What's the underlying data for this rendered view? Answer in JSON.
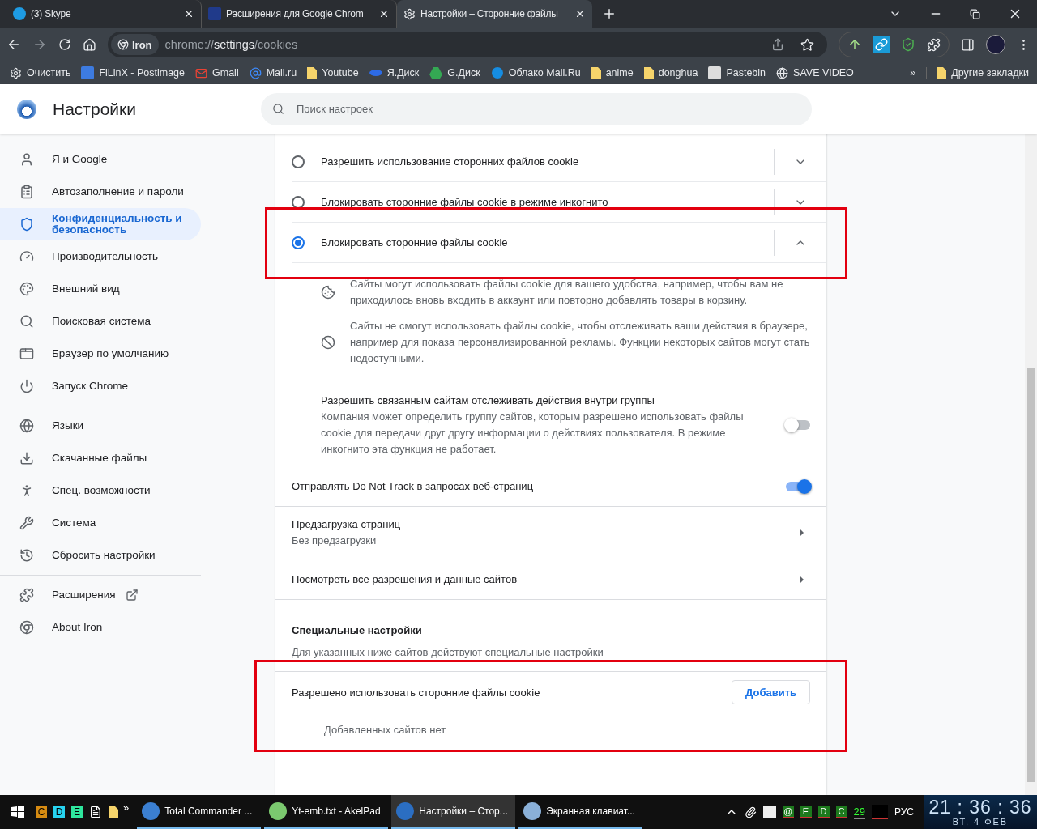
{
  "tabs": [
    {
      "title": "(3) Skype",
      "selected": false
    },
    {
      "title": "Расширения для Google Chrom",
      "selected": false
    },
    {
      "title": "Настройки – Сторонние файлы",
      "selected": true
    }
  ],
  "address": {
    "badge": "Iron",
    "url_scheme": "chrome://",
    "url_host": "settings",
    "url_path": "/cookies"
  },
  "bookmarks": [
    {
      "label": "Очистить"
    },
    {
      "label": "FiLinX - Postimage"
    },
    {
      "label": "Gmail"
    },
    {
      "label": "Mail.ru"
    },
    {
      "label": "Youtube"
    },
    {
      "label": "Я.Диск"
    },
    {
      "label": "G.Диск"
    },
    {
      "label": "Облако Mail.Ru"
    },
    {
      "label": "anime"
    },
    {
      "label": "donghua"
    },
    {
      "label": "Pastebin"
    },
    {
      "label": "SAVE VIDEO"
    }
  ],
  "bookmarks_overflow": "»",
  "other_bookmarks": "Другие закладки",
  "settings": {
    "title": "Настройки",
    "search_placeholder": "Поиск настроек"
  },
  "sidebar": {
    "groups": [
      [
        {
          "label": "Я и Google",
          "selected": false
        },
        {
          "label": "Автозаполнение и пароли",
          "selected": false
        },
        {
          "label": "Конфиденциальность и безопасность",
          "selected": true
        },
        {
          "label": "Производительность",
          "selected": false
        },
        {
          "label": "Внешний вид",
          "selected": false
        },
        {
          "label": "Поисковая система",
          "selected": false
        },
        {
          "label": "Браузер по умолчанию",
          "selected": false
        },
        {
          "label": "Запуск Chrome",
          "selected": false
        }
      ],
      [
        {
          "label": "Языки",
          "selected": false
        },
        {
          "label": "Скачанные файлы",
          "selected": false
        },
        {
          "label": "Спец. возможности",
          "selected": false
        },
        {
          "label": "Система",
          "selected": false
        },
        {
          "label": "Сбросить настройки",
          "selected": false
        }
      ],
      [
        {
          "label": "Расширения",
          "selected": false
        },
        {
          "label": "About Iron",
          "selected": false
        }
      ]
    ]
  },
  "cookie_options": [
    {
      "label": "Разрешить использование сторонних файлов cookie",
      "selected": false,
      "expanded": false,
      "highlighted": false
    },
    {
      "label": "Блокировать сторонние файлы cookie в режиме инкогнито",
      "selected": false,
      "expanded": false,
      "highlighted": false
    },
    {
      "label": "Блокировать сторонние файлы cookie",
      "selected": true,
      "expanded": true,
      "highlighted": true
    }
  ],
  "details": [
    {
      "kind": "allow",
      "text": "Сайты могут использовать файлы cookie для вашего удобства, например, чтобы вам не приходилось вновь входить в аккаунт или повторно добавлять товары в корзину."
    },
    {
      "kind": "block",
      "text": "Сайты не смогут использовать файлы cookie, чтобы отслеживать ваши действия в браузере, например для показа персонализированной рекламы. Функции некоторых сайтов могут стать недоступными."
    }
  ],
  "related_sites": {
    "title": "Разрешить связанным сайтам отслеживать действия внутри группы",
    "description": "Компания может определить группу сайтов, которым разрешено использовать файлы cookie для передачи друг другу информации о действиях пользователя. В режиме инкогнито эта функция не работает.",
    "on": false
  },
  "rows": [
    {
      "kind": "toggle",
      "title": "Отправлять Do Not Track в запросах веб-страниц",
      "on": true
    },
    {
      "kind": "link",
      "title": "Предзагрузка страниц",
      "subtitle": "Без предзагрузки"
    },
    {
      "kind": "link",
      "title": "Посмотреть все разрешения и данные сайтов"
    }
  ],
  "special": {
    "heading": "Специальные настройки",
    "description": "Для указанных ниже сайтов действуют специальные настройки",
    "highlighted": true,
    "allowed_label": "Разрешено использовать сторонние файлы cookie",
    "add_button": "Добавить",
    "empty": "Добавленных сайтов нет"
  },
  "taskbar": {
    "quick_launch": [
      "C",
      "D",
      "E"
    ],
    "overflow": "»",
    "tasks": [
      {
        "title": "Total Commander ...",
        "selected": false
      },
      {
        "title": "Yt-emb.txt - AkelPad",
        "selected": false
      },
      {
        "title": "Настройки – Стор...",
        "selected": true
      },
      {
        "title": "Экранная клавиат...",
        "selected": false
      }
    ],
    "tray_letters": [
      "@",
      "E",
      "D",
      "C"
    ],
    "tray_counter": "29",
    "language": "РУС",
    "time": "21 : 36 : 36",
    "date": "ВТ, 4 ФЕВ"
  }
}
